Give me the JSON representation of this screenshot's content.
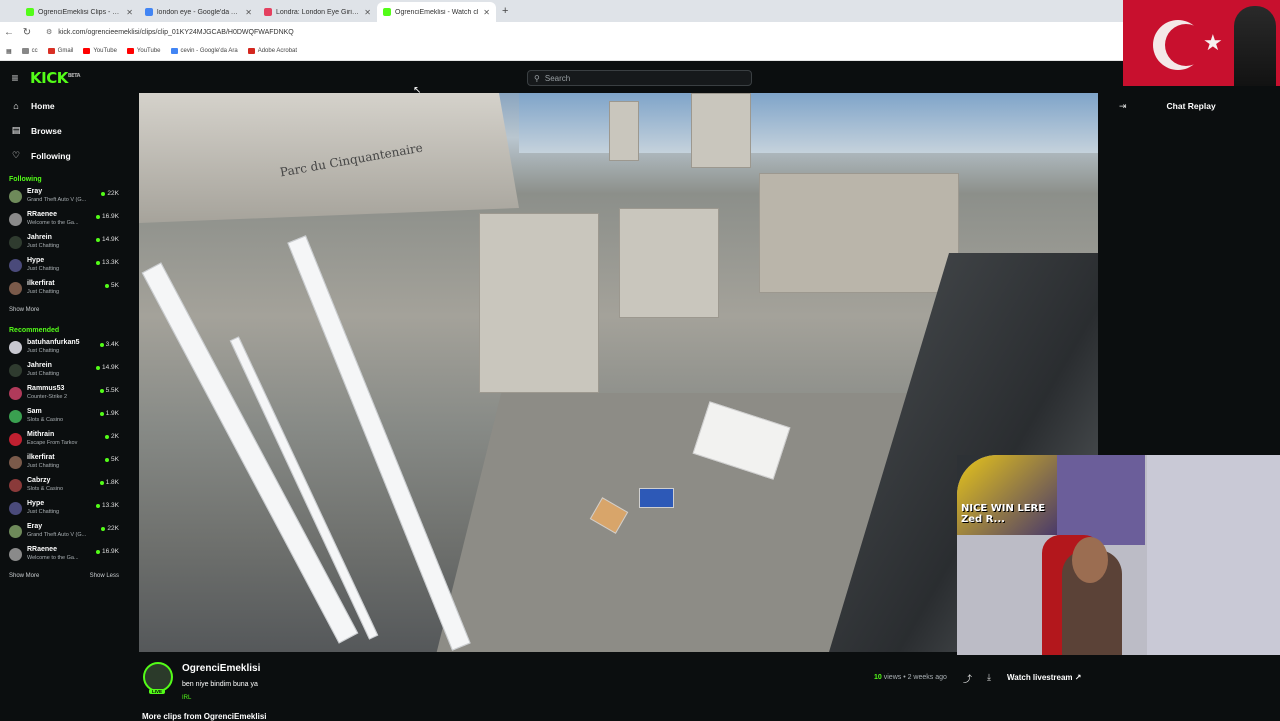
{
  "browser": {
    "tabs": [
      {
        "title": "OgrenciEmeklisi Clips - Watch",
        "color": "#53fc18",
        "active": false
      },
      {
        "title": "london eye - Google'da Ara",
        "color": "#4285f4",
        "active": false
      },
      {
        "title": "Londra: London Eye Giriş Bileti",
        "color": "#e4405f",
        "active": false
      },
      {
        "title": "OgrenciEmeklisi - Watch cl",
        "color": "#53fc18",
        "active": true
      }
    ],
    "new_tab": "+",
    "url": "kick.com/ogrencieemeklisi/clips/clip_01KY24MJGCAB/H0DWQFWAFDNKQ",
    "bookmarks": [
      {
        "label": "cc",
        "color": "#888888"
      },
      {
        "label": "Gmail",
        "color": "#d93025"
      },
      {
        "label": "YouTube",
        "color": "#ff0000"
      },
      {
        "label": "YouTube",
        "color": "#ff0000"
      },
      {
        "label": "cevin - Google'da Ara",
        "color": "#4285f4"
      },
      {
        "label": "Adobe Acrobat",
        "color": "#d4271f"
      }
    ]
  },
  "header": {
    "logo": "KICK",
    "logo_sup": "BETA",
    "search_placeholder": "Search"
  },
  "sidebar": {
    "nav": [
      {
        "label": "Home",
        "icon": "home-icon",
        "glyph": "⌂"
      },
      {
        "label": "Browse",
        "icon": "browse-icon",
        "glyph": "▤"
      },
      {
        "label": "Following",
        "icon": "heart-icon",
        "glyph": "♡"
      }
    ],
    "following_title": "Following",
    "following": [
      {
        "name": "Eray",
        "category": "Grand Theft Auto V (G...",
        "viewers": "22K",
        "color": "#6e8a5a"
      },
      {
        "name": "RRaenee",
        "category": "Welcome to the Ga...",
        "viewers": "16.9K",
        "color": "#8a8a8a"
      },
      {
        "name": "Jahrein",
        "category": "Just Chatting",
        "viewers": "14.9K",
        "color": "#2f3b2f"
      },
      {
        "name": "Hype",
        "category": "Just Chatting",
        "viewers": "13.3K",
        "color": "#4a4a7a"
      },
      {
        "name": "ilkerfirat",
        "category": "Just Chatting",
        "viewers": "5K",
        "color": "#7a5a4a"
      }
    ],
    "show_more_1": "Show More",
    "recommended_title": "Recommended",
    "recommended": [
      {
        "name": "batuhanfurkan5",
        "category": "Just Chatting",
        "viewers": "3.4K",
        "color": "#c8c8d0"
      },
      {
        "name": "Jahrein",
        "category": "Just Chatting",
        "viewers": "14.9K",
        "color": "#2f3b2f"
      },
      {
        "name": "Rammus53",
        "category": "Counter-Strike 2",
        "viewers": "5.5K",
        "color": "#b03a5a"
      },
      {
        "name": "Sam",
        "category": "Slots & Casino",
        "viewers": "1.9K",
        "color": "#3aa050"
      },
      {
        "name": "Mithrain",
        "category": "Escape From Tarkov",
        "viewers": "2K",
        "color": "#c02030"
      },
      {
        "name": "ilkerfirat",
        "category": "Just Chatting",
        "viewers": "5K",
        "color": "#7a5a4a"
      },
      {
        "name": "Cabrzy",
        "category": "Slots & Casino",
        "viewers": "1.8K",
        "color": "#8a3a3a"
      },
      {
        "name": "Hype",
        "category": "Just Chatting",
        "viewers": "13.3K",
        "color": "#4a4a7a"
      },
      {
        "name": "Eray",
        "category": "Grand Theft Auto V (G...",
        "viewers": "22K",
        "color": "#6e8a5a"
      },
      {
        "name": "RRaenee",
        "category": "Welcome to the Ga...",
        "viewers": "16.9K",
        "color": "#8a8a8a"
      }
    ],
    "show_more_2": "Show More",
    "show_less": "Show Less"
  },
  "video": {
    "sign_text": "Parc du Cinquantenaire",
    "overlay_text": "NICE WIN LERE Zed R..."
  },
  "chat": {
    "title": "Chat Replay"
  },
  "clip": {
    "channel": "OgrenciEmeklisi",
    "live_badge": "LIVE",
    "title": "ben niye bindim buna ya",
    "category": "IRL",
    "views_count": "10",
    "views_rest": " views • 2 weeks ago",
    "watch_label": "Watch livestream",
    "more_clips": "More clips from OgrenciEmeklisi"
  },
  "colors": {
    "accent": "#53fc18",
    "bg": "#0b0e0f"
  }
}
